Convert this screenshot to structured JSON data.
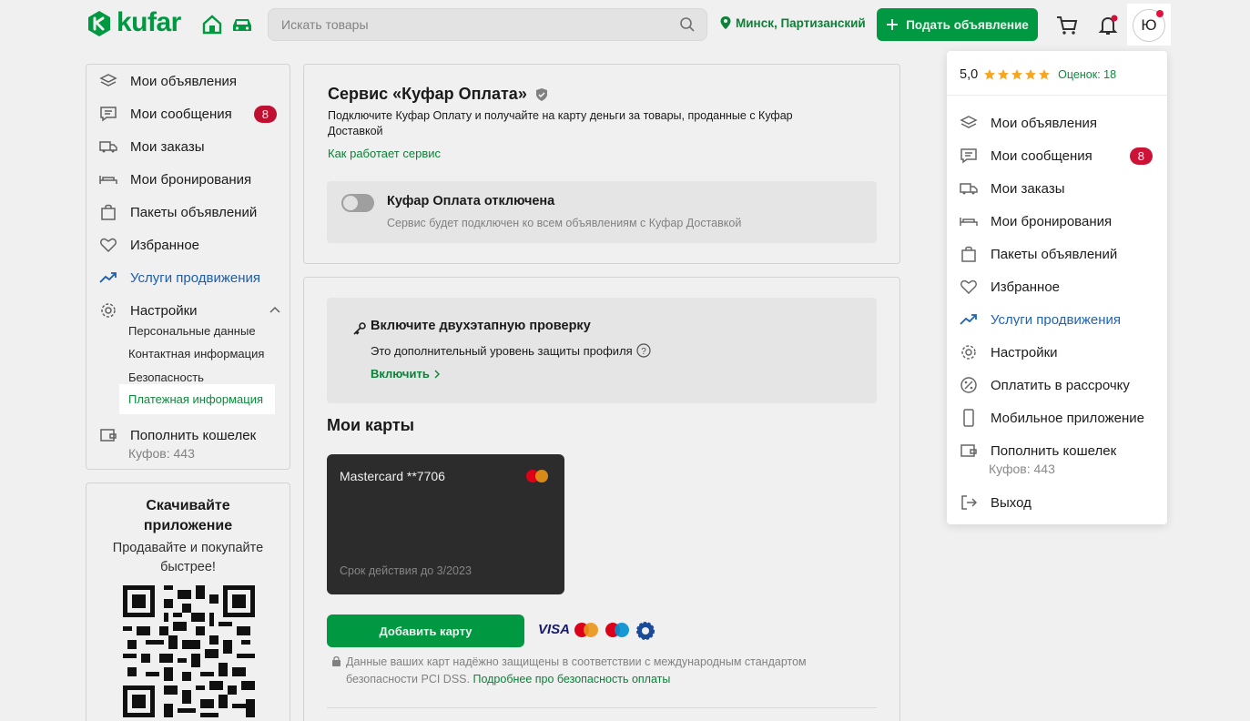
{
  "header": {
    "logo_text": "kufar",
    "search_placeholder": "Искать товары",
    "location": "Минск, Партизанский",
    "post_button": "Подать объявление",
    "avatar_letter": "Ю"
  },
  "left_nav": {
    "items": [
      {
        "label": "Мои объявления",
        "icon": "layers-icon"
      },
      {
        "label": "Мои сообщения",
        "icon": "message-icon",
        "badge": "8"
      },
      {
        "label": "Мои заказы",
        "icon": "truck-icon"
      },
      {
        "label": "Мои бронирования",
        "icon": "bed-icon"
      },
      {
        "label": "Пакеты объявлений",
        "icon": "bag-icon"
      },
      {
        "label": "Избранное",
        "icon": "heart-icon"
      },
      {
        "label": "Услуги продвижения",
        "icon": "trend-icon"
      },
      {
        "label": "Настройки",
        "icon": "gear-icon"
      }
    ],
    "settings_sub": [
      "Персональные данные",
      "Контактная информация",
      "Безопасность",
      "Платежная информация"
    ],
    "wallet_label": "Пополнить кошелек",
    "wallet_balance": "Куфов: 443"
  },
  "app_promo": {
    "title": "Скачивайте приложение",
    "subtitle": "Продавайте и покупайте быстрее!"
  },
  "payment": {
    "title": "Сервис «Куфар Оплата»",
    "description": "Подключите Куфар Оплату и получайте на карту деньги за товары, проданные с Куфар Доставкой",
    "how_link": "Как работает сервис",
    "toggle_title": "Куфар Оплата отключена",
    "toggle_desc": "Сервис будет подключен ко всем объявлениям с Куфар Доставкой"
  },
  "twofa": {
    "title": "Включите двухэтапную проверку",
    "desc": "Это дополнительный уровень защиты профиля",
    "action": "Включить"
  },
  "cards": {
    "title": "Мои карты",
    "card_name": "Mastercard **7706",
    "card_expiry": "Срок действия до 3/2023",
    "add_button": "Добавить карту",
    "visa_label": "VISA",
    "security_text": "Данные ваших карт надёжно защищены в соответствии с международным стандартом безопасности PCI DSS.",
    "security_link": "Подробнее про безопасность оплаты"
  },
  "dropdown": {
    "rating": "5,0",
    "rating_stars": 5,
    "reviews": "Оценок: 18",
    "items": [
      {
        "label": "Мои объявления",
        "icon": "layers-icon"
      },
      {
        "label": "Мои сообщения",
        "icon": "message-icon",
        "badge": "8"
      },
      {
        "label": "Мои заказы",
        "icon": "truck-icon"
      },
      {
        "label": "Мои бронирования",
        "icon": "bed-icon"
      },
      {
        "label": "Пакеты объявлений",
        "icon": "bag-icon"
      },
      {
        "label": "Избранное",
        "icon": "heart-icon"
      },
      {
        "label": "Услуги продвижения",
        "icon": "trend-icon"
      },
      {
        "label": "Настройки",
        "icon": "gear-icon"
      },
      {
        "label": "Оплатить в рассрочку",
        "icon": "percent-icon"
      },
      {
        "label": "Мобильное приложение",
        "icon": "phone-icon"
      },
      {
        "label": "Пополнить кошелек",
        "icon": "wallet-icon",
        "sub": "Куфов: 443"
      },
      {
        "label": "Выход",
        "icon": "logout-icon"
      }
    ]
  },
  "colors": {
    "brand": "#00a347",
    "badge": "#cc1236",
    "promo": "#1f63b7"
  }
}
